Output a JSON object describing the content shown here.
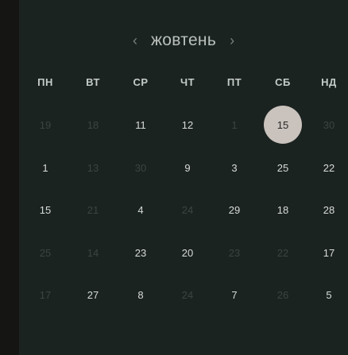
{
  "calendar": {
    "month_label": "жовтень",
    "prev_label": "‹",
    "next_label": "›",
    "weekdays": [
      "ПН",
      "ВТ",
      "СР",
      "ЧТ",
      "ПТ",
      "СБ",
      "НД"
    ],
    "weeks": [
      [
        {
          "label": "19",
          "muted": true
        },
        {
          "label": "18",
          "muted": true
        },
        {
          "label": "11",
          "muted": false
        },
        {
          "label": "12",
          "muted": false
        },
        {
          "label": "1",
          "muted": true
        },
        {
          "label": "15",
          "muted": false,
          "selected": true
        },
        {
          "label": "30",
          "muted": true
        }
      ],
      [
        {
          "label": "1",
          "muted": false
        },
        {
          "label": "13",
          "muted": true
        },
        {
          "label": "30",
          "muted": true
        },
        {
          "label": "9",
          "muted": false
        },
        {
          "label": "3",
          "muted": false
        },
        {
          "label": "25",
          "muted": false
        },
        {
          "label": "22",
          "muted": false
        }
      ],
      [
        {
          "label": "15",
          "muted": false
        },
        {
          "label": "21",
          "muted": true
        },
        {
          "label": "4",
          "muted": false
        },
        {
          "label": "24",
          "muted": true
        },
        {
          "label": "29",
          "muted": false
        },
        {
          "label": "18",
          "muted": false
        },
        {
          "label": "28",
          "muted": false
        }
      ],
      [
        {
          "label": "25",
          "muted": true
        },
        {
          "label": "14",
          "muted": true
        },
        {
          "label": "23",
          "muted": false
        },
        {
          "label": "20",
          "muted": false
        },
        {
          "label": "23",
          "muted": true
        },
        {
          "label": "22",
          "muted": true
        },
        {
          "label": "17",
          "muted": false
        }
      ],
      [
        {
          "label": "17",
          "muted": true
        },
        {
          "label": "27",
          "muted": false
        },
        {
          "label": "8",
          "muted": false
        },
        {
          "label": "24",
          "muted": true
        },
        {
          "label": "7",
          "muted": false
        },
        {
          "label": "26",
          "muted": true
        },
        {
          "label": "5",
          "muted": false
        }
      ]
    ]
  },
  "colors": {
    "panel_bg": "#1b2321",
    "selected_bg": "#c9c2bd",
    "text": "#d6dbd8",
    "muted_text": "#3b4441"
  }
}
